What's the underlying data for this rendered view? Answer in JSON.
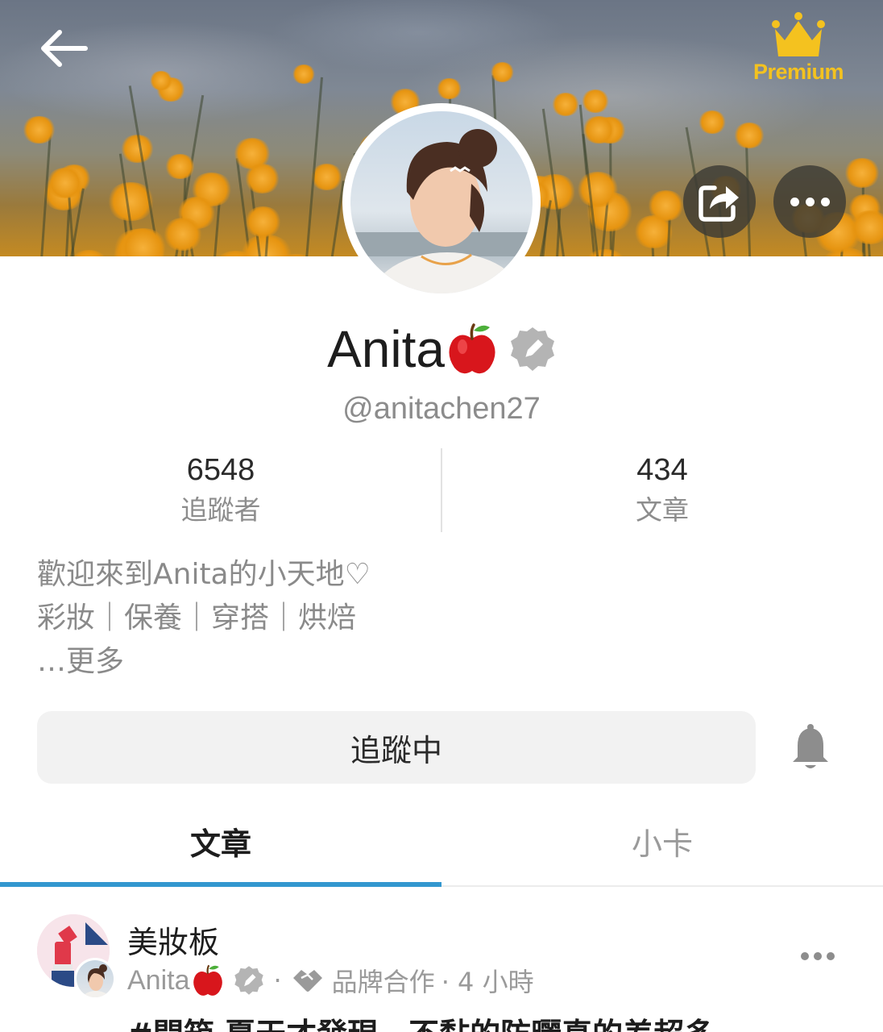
{
  "cover": {
    "premium_label": "Premium",
    "back_icon": "arrow-left-icon",
    "share_icon": "share-icon",
    "more_icon": "more-horizontal-icon"
  },
  "profile": {
    "display_name": "Anita",
    "name_emoji": "apple-emoji",
    "verified_icon": "writer-badge-icon",
    "username": "@anitachen27"
  },
  "stats": [
    {
      "value": "6548",
      "label": "追蹤者"
    },
    {
      "value": "434",
      "label": "文章"
    }
  ],
  "bio": {
    "line1": "歡迎來到Anita的小天地♡",
    "line2": "彩妝｜保養｜穿搭｜烘焙",
    "more": "…更多"
  },
  "actions": {
    "follow_label": "追蹤中",
    "bell_icon": "bell-icon"
  },
  "tabs": [
    {
      "label": "文章",
      "active": true
    },
    {
      "label": "小卡",
      "active": false
    }
  ],
  "post": {
    "board": "美妝板",
    "author": "Anita",
    "dot": "·",
    "partner_label": "品牌合作",
    "time": "· 4 小時",
    "title": "#開箱 夏天才發現，不黏的防曬真的差超多"
  },
  "colors": {
    "accent": "#3397cf",
    "premium": "#f4c21f",
    "follow_bg": "#f2f2f2",
    "muted_text": "#8a8a8a"
  }
}
